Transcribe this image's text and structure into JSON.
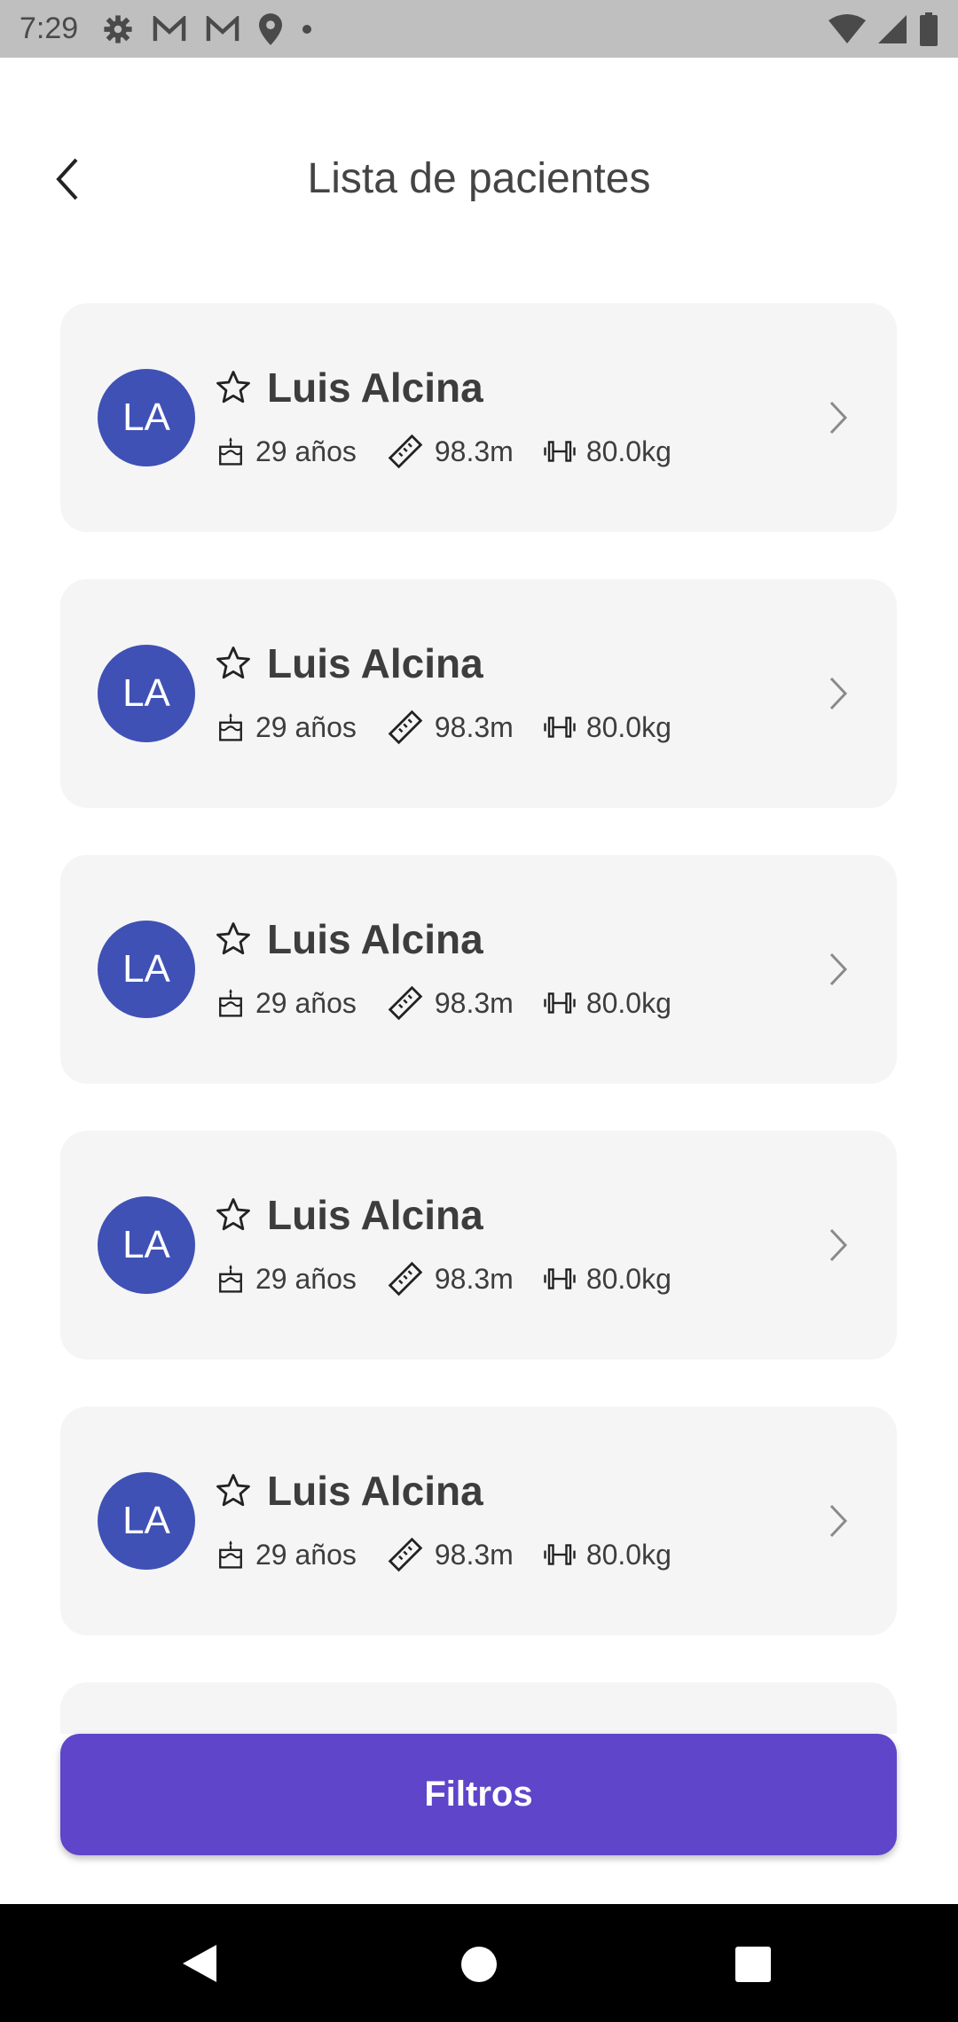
{
  "status_bar": {
    "time": "7:29",
    "icons": [
      "gear-icon",
      "gmail-icon",
      "gmail-icon",
      "location-icon",
      "dot-icon"
    ],
    "right_icons": [
      "wifi-icon",
      "signal-icon",
      "battery-icon"
    ]
  },
  "header": {
    "title": "Lista de pacientes"
  },
  "patients": [
    {
      "initials": "LA",
      "name": "Luis Alcina",
      "age": "29 años",
      "height": "98.3m",
      "weight": "80.0kg"
    },
    {
      "initials": "LA",
      "name": "Luis Alcina",
      "age": "29 años",
      "height": "98.3m",
      "weight": "80.0kg"
    },
    {
      "initials": "LA",
      "name": "Luis Alcina",
      "age": "29 años",
      "height": "98.3m",
      "weight": "80.0kg"
    },
    {
      "initials": "LA",
      "name": "Luis Alcina",
      "age": "29 años",
      "height": "98.3m",
      "weight": "80.0kg"
    },
    {
      "initials": "LA",
      "name": "Luis Alcina",
      "age": "29 años",
      "height": "98.3m",
      "weight": "80.0kg"
    }
  ],
  "filter_button": {
    "label": "Filtros"
  },
  "colors": {
    "avatar": "#3f51b5",
    "button": "#5e45c9",
    "card": "#f5f5f5"
  }
}
